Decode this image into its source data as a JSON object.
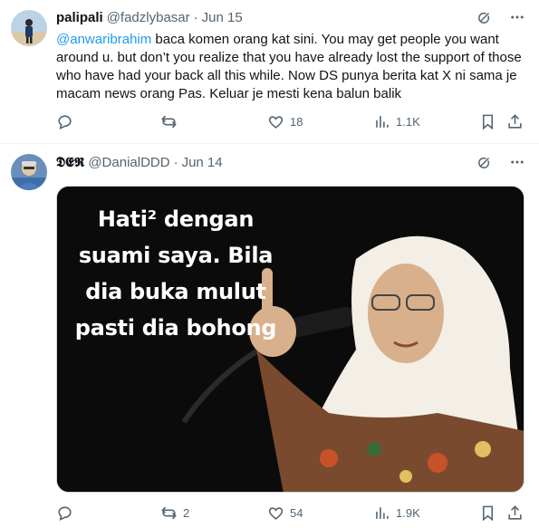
{
  "tweets": [
    {
      "display_name": "palipali",
      "handle": "@fadzlybasar",
      "separator": "·",
      "date": "Jun 15",
      "mention": "@anwaribrahim",
      "text": " baca komen orang kat sini. You may get people you want around u. but don’t you realize that you have already lost the support of those who have had your back all this while. Now DS punya berita kat X ni sama je macam news orang Pas. Keluar je mesti kena balun balik",
      "actions": {
        "replies": "",
        "reposts": "",
        "likes": "18",
        "views": "1.1K"
      }
    },
    {
      "display_name": "𝕯𝕰𝕽",
      "handle": "@DanialDDD",
      "separator": "·",
      "date": "Jun 14",
      "meme_text": "Hati² dengan suami saya. Bila dia buka mulut pasti dia bohong",
      "actions": {
        "replies": "",
        "reposts": "2",
        "likes": "54",
        "views": "1.9K"
      }
    }
  ],
  "icons": [
    "grok-icon",
    "more-icon",
    "reply-icon",
    "repost-icon",
    "like-icon",
    "views-icon",
    "bookmark-icon",
    "share-icon"
  ],
  "colors": {
    "link": "#1d9bf0",
    "secondary_text": "#536471",
    "hijab": "#f3efe6",
    "border": "#eff3f4"
  }
}
